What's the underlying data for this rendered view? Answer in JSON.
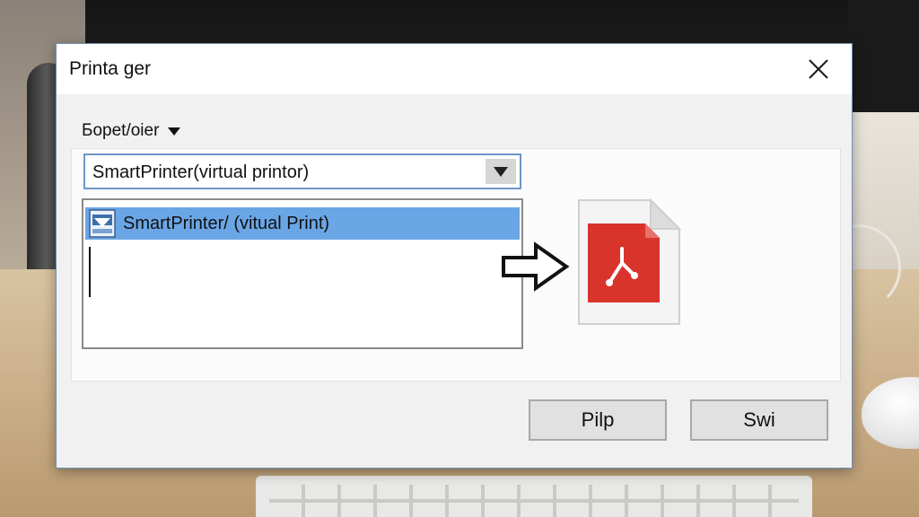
{
  "dialog": {
    "title": "Printa ger",
    "section_label": "Бopet/oier",
    "printer_select": {
      "selected_value": "SmartPrinter(virtual printor)"
    },
    "printer_list": {
      "items": [
        {
          "label": "SmartPrinter/ (vitual Print)",
          "selected": true
        }
      ]
    },
    "buttons": {
      "primary_label": "Pilp",
      "secondary_label": "Swi"
    }
  },
  "icons": {
    "close": "close-icon",
    "dropdown": "chevron-down-icon",
    "printer": "printer-icon",
    "arrow": "arrow-right-icon",
    "pdf": "pdf-file-icon"
  },
  "colors": {
    "selection": "#6aa6e6",
    "select_border": "#6e95c9",
    "pdf_red": "#d9342b"
  }
}
